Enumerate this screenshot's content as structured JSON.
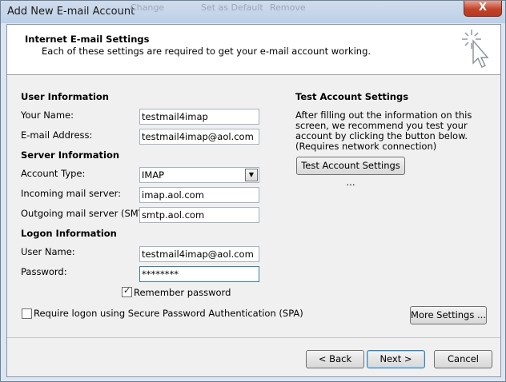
{
  "window": {
    "title": "Add New E-mail Account",
    "close_glyph": "X",
    "background_ghost": [
      "Change",
      "Set as Default",
      "Remove"
    ]
  },
  "header": {
    "title": "Internet E-mail Settings",
    "subtitle": "Each of these settings are required to get your e-mail account working."
  },
  "user_info": {
    "heading": "User Information",
    "name_label": "Your Name:",
    "name_value": "testmail4imap",
    "email_label": "E-mail Address:",
    "email_value": "testmail4imap@aol.com"
  },
  "server_info": {
    "heading": "Server Information",
    "account_type_label": "Account Type:",
    "account_type_value": "IMAP",
    "incoming_label": "Incoming mail server:",
    "incoming_value": "imap.aol.com",
    "outgoing_label": "Outgoing mail server (SMTP):",
    "outgoing_value": "smtp.aol.com"
  },
  "logon_info": {
    "heading": "Logon Information",
    "username_label": "User Name:",
    "username_value": "testmail4imap@aol.com",
    "password_label": "Password:",
    "password_value": "********",
    "remember_label": "Remember password",
    "remember_checked": true,
    "spa_label": "Require logon using Secure Password Authentication (SPA)",
    "spa_checked": false
  },
  "test_settings": {
    "heading": "Test Account Settings",
    "description": "After filling out the information on this screen, we recommend you test your account by clicking the button below. (Requires network connection)",
    "test_button": "Test Account Settings ..."
  },
  "buttons": {
    "more_settings": "More Settings ...",
    "back": "< Back",
    "next": "Next >",
    "cancel": "Cancel"
  }
}
